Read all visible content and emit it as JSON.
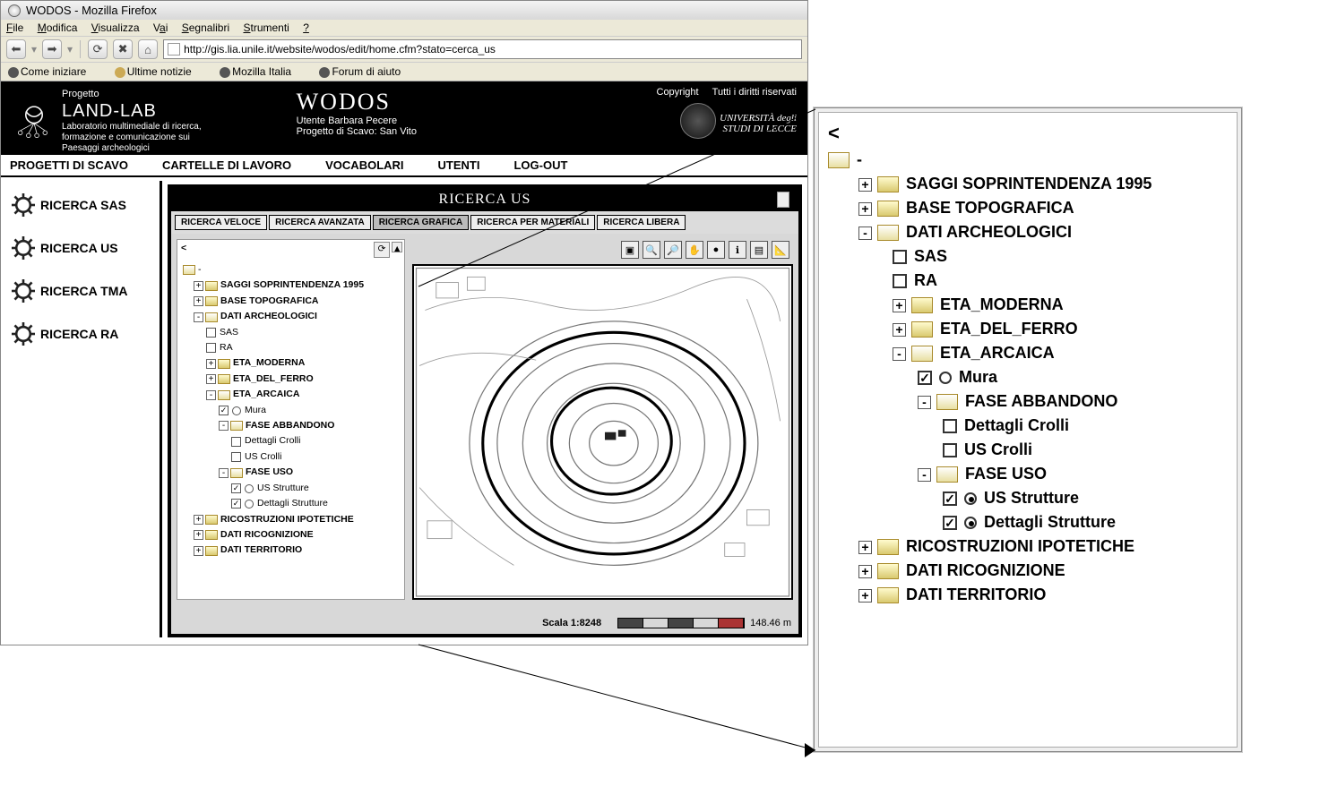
{
  "window": {
    "title": "WODOS - Mozilla Firefox"
  },
  "menubar": [
    "File",
    "Modifica",
    "Visualizza",
    "Vai",
    "Segnalibri",
    "Strumenti",
    "?"
  ],
  "url": "http://gis.lia.unile.it/website/wodos/edit/home.cfm?stato=cerca_us",
  "bookmarks": [
    "Come iniziare",
    "Ultime notizie",
    "Mozilla Italia",
    "Forum di aiuto"
  ],
  "header": {
    "project_small": "Progetto",
    "project_big": "LAND-LAB",
    "project_sub1": "Laboratorio multimediale di ricerca,",
    "project_sub2": "formazione e comunicazione sui",
    "project_sub3": "Paesaggi archeologici",
    "app_title": "WODOS",
    "user_line": "Utente Barbara Pecere",
    "project_line": "Progetto di Scavo: San Vito",
    "copyright": "Copyright",
    "rights": "Tutti i diritti riservati",
    "uni1": "UNIVERSITÀ degli",
    "uni2": "STUDI DI LECCE"
  },
  "topnav": [
    "PROGETTI DI SCAVO",
    "CARTELLE DI LAVORO",
    "VOCABOLARI",
    "UTENTI",
    "LOG-OUT"
  ],
  "sidebar": [
    "RICERCA SAS",
    "RICERCA US",
    "RICERCA TMA",
    "RICERCA RA"
  ],
  "panel_title": "RICERCA US",
  "search_tabs": [
    "RICERCA VELOCE",
    "RICERCA AVANZATA",
    "RICERCA GRAFICA",
    "RICERCA PER MATERIALI",
    "RICERCA LIBERA"
  ],
  "active_tab_index": 2,
  "tree_root": "-",
  "tree": [
    {
      "d": 0,
      "t": "+",
      "f": "c",
      "lbl": "SAGGI SOPRINTENDENZA 1995",
      "bold": true
    },
    {
      "d": 0,
      "t": "+",
      "f": "c",
      "lbl": "BASE TOPOGRAFICA",
      "bold": true
    },
    {
      "d": 0,
      "t": "-",
      "f": "o",
      "lbl": "DATI ARCHEOLOGICI",
      "bold": true
    },
    {
      "d": 1,
      "cb": "",
      "lbl": "SAS"
    },
    {
      "d": 1,
      "cb": "",
      "lbl": "RA"
    },
    {
      "d": 1,
      "t": "+",
      "f": "c",
      "lbl": "ETA_MODERNA",
      "bold": true
    },
    {
      "d": 1,
      "t": "+",
      "f": "c",
      "lbl": "ETA_DEL_FERRO",
      "bold": true
    },
    {
      "d": 1,
      "t": "-",
      "f": "o",
      "lbl": "ETA_ARCAICA",
      "bold": true
    },
    {
      "d": 2,
      "cb": "✓",
      "rb": "",
      "lbl": "Mura"
    },
    {
      "d": 2,
      "t": "-",
      "f": "o",
      "lbl": "FASE ABBANDONO",
      "bold": true
    },
    {
      "d": 3,
      "cb": "",
      "lbl": "Dettagli Crolli"
    },
    {
      "d": 3,
      "cb": "",
      "lbl": "US Crolli"
    },
    {
      "d": 2,
      "t": "-",
      "f": "o",
      "lbl": "FASE USO",
      "bold": true
    },
    {
      "d": 3,
      "cb": "✓",
      "rb": "",
      "lbl": "US Strutture"
    },
    {
      "d": 3,
      "cb": "✓",
      "rb": "",
      "lbl": "Dettagli Strutture"
    },
    {
      "d": 0,
      "t": "+",
      "f": "c",
      "lbl": "RICOSTRUZIONI IPOTETICHE",
      "bold": true
    },
    {
      "d": 0,
      "t": "+",
      "f": "c",
      "lbl": "DATI RICOGNIZIONE",
      "bold": true
    },
    {
      "d": 0,
      "t": "+",
      "f": "c",
      "lbl": "DATI TERRITORIO",
      "bold": true
    }
  ],
  "ztree": [
    {
      "d": 0,
      "t": "+",
      "f": "c",
      "lbl": "SAGGI SOPRINTENDENZA 1995"
    },
    {
      "d": 0,
      "t": "+",
      "f": "c",
      "lbl": "BASE TOPOGRAFICA"
    },
    {
      "d": 0,
      "t": "-",
      "f": "o",
      "lbl": "DATI ARCHEOLOGICI"
    },
    {
      "d": 1,
      "cb": "",
      "lbl": "SAS"
    },
    {
      "d": 1,
      "cb": "",
      "lbl": "RA"
    },
    {
      "d": 1,
      "t": "+",
      "f": "c",
      "lbl": "ETA_MODERNA"
    },
    {
      "d": 1,
      "t": "+",
      "f": "c",
      "lbl": "ETA_DEL_FERRO"
    },
    {
      "d": 1,
      "t": "-",
      "f": "o",
      "lbl": "ETA_ARCAICA"
    },
    {
      "d": 2,
      "cb": "✓",
      "rb": "",
      "lbl": "Mura"
    },
    {
      "d": 2,
      "t": "-",
      "f": "o",
      "lbl": "FASE ABBANDONO"
    },
    {
      "d": 3,
      "cb": "",
      "lbl": "Dettagli Crolli"
    },
    {
      "d": 3,
      "cb": "",
      "lbl": "US Crolli"
    },
    {
      "d": 2,
      "t": "-",
      "f": "o",
      "lbl": "FASE USO"
    },
    {
      "d": 3,
      "cb": "✓",
      "rb": "sel",
      "lbl": "US Strutture"
    },
    {
      "d": 3,
      "cb": "✓",
      "rb": "sel",
      "lbl": "Dettagli Strutture"
    },
    {
      "d": 0,
      "t": "+",
      "f": "c",
      "lbl": "RICOSTRUZIONI IPOTETICHE"
    },
    {
      "d": 0,
      "t": "+",
      "f": "c",
      "lbl": "DATI RICOGNIZIONE"
    },
    {
      "d": 0,
      "t": "+",
      "f": "c",
      "lbl": "DATI TERRITORIO"
    }
  ],
  "scale": {
    "label": "Scala 1:8248",
    "bar_label": "Scale bar",
    "distance": "148.46 m"
  }
}
